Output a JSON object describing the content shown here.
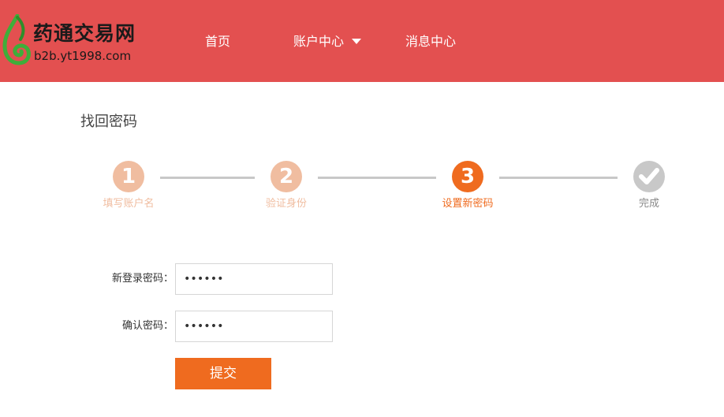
{
  "header": {
    "logo_title": "药通交易网",
    "logo_url": "b2b.yt1998.com",
    "nav": {
      "home": "首页",
      "account": "账户中心",
      "messages": "消息中心"
    }
  },
  "page_title": "找回密码",
  "steps": [
    {
      "number": "1",
      "label": "填写账户名",
      "state": "done"
    },
    {
      "number": "2",
      "label": "验证身份",
      "state": "done"
    },
    {
      "number": "3",
      "label": "设置新密码",
      "state": "current"
    },
    {
      "number": "",
      "label": "完成",
      "state": "pending",
      "icon": "check-icon"
    }
  ],
  "form": {
    "new_password_label": "新登录密码：",
    "new_password_value": "••••••",
    "confirm_password_label": "确认密码：",
    "confirm_password_value": "••••••",
    "submit_label": "提交"
  },
  "colors": {
    "header_bg": "#e35050",
    "step_done": "#f0bda0",
    "step_current": "#ef6b1f",
    "step_pending": "#c8c8c8",
    "button": "#ef6b1f"
  }
}
